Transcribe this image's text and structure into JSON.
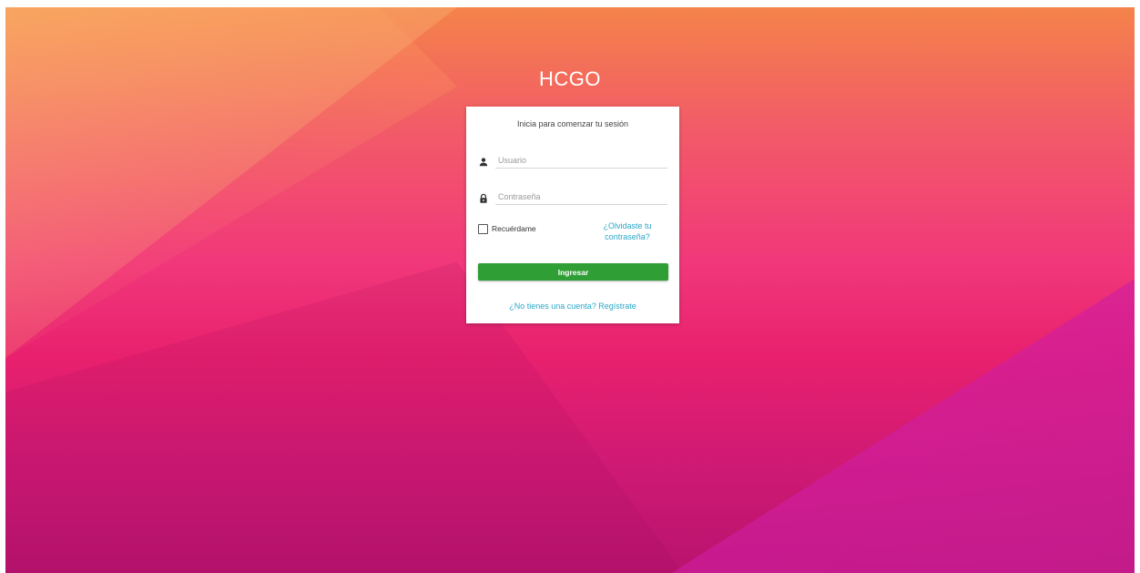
{
  "brand": {
    "title": "HCGO"
  },
  "login": {
    "subtitle": "Inicia para comenzar tu sesión",
    "username": {
      "placeholder": "Usuario",
      "value": "",
      "icon": "user-icon"
    },
    "password": {
      "placeholder": "Contraseña",
      "value": "",
      "icon": "lock-icon"
    },
    "remember_label": "Recuérdame",
    "remember_checked": false,
    "forgot_label_line1": "¿Olvidaste tu",
    "forgot_label_line2": "contraseña?",
    "submit_label": "Ingresar",
    "register_label": "¿No tienes una cuenta? Regístrate"
  },
  "colors": {
    "submit": "#2f9e34",
    "link": "#2aa7c8",
    "background_top": "#f4834a",
    "background_bottom": "#b8136e"
  }
}
